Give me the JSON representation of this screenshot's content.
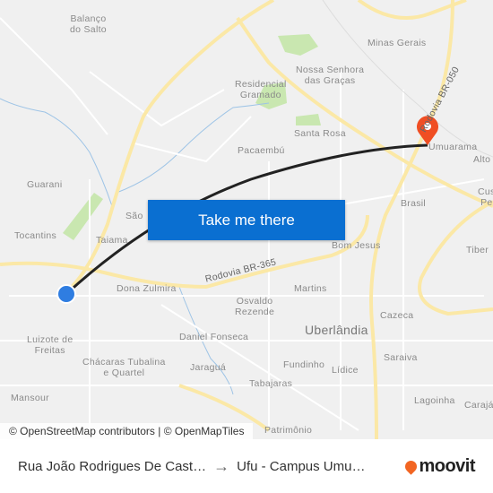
{
  "map": {
    "labels": [
      {
        "text": "Balanço\ndo Salto",
        "cls": ""
      },
      {
        "text": "Minas Gerais",
        "cls": ""
      },
      {
        "text": "Nossa Senhora\ndas Graças",
        "cls": ""
      },
      {
        "text": "Residencial\nGramado",
        "cls": ""
      },
      {
        "text": "Santa Rosa",
        "cls": ""
      },
      {
        "text": "Pacaembú",
        "cls": ""
      },
      {
        "text": "Umuarama",
        "cls": ""
      },
      {
        "text": "Alto",
        "cls": ""
      },
      {
        "text": "Guarani",
        "cls": ""
      },
      {
        "text": "Brasil",
        "cls": ""
      },
      {
        "text": "Cus\nPe",
        "cls": ""
      },
      {
        "text": "São",
        "cls": ""
      },
      {
        "text": "Tocantins",
        "cls": ""
      },
      {
        "text": "Taiama",
        "cls": ""
      },
      {
        "text": "Bom Jesus",
        "cls": ""
      },
      {
        "text": "Tiber",
        "cls": ""
      },
      {
        "text": "Dona Zulmira",
        "cls": ""
      },
      {
        "text": "Martins",
        "cls": ""
      },
      {
        "text": "Osvaldo\nRezende",
        "cls": ""
      },
      {
        "text": "Uberlândia",
        "cls": "city"
      },
      {
        "text": "Cazeca",
        "cls": ""
      },
      {
        "text": "Luizote de\nFreitas",
        "cls": ""
      },
      {
        "text": "Daniel Fonseca",
        "cls": ""
      },
      {
        "text": "Saraiva",
        "cls": ""
      },
      {
        "text": "Chácaras Tubalina\ne Quartel",
        "cls": ""
      },
      {
        "text": "Jaraguá",
        "cls": ""
      },
      {
        "text": "Fundinho",
        "cls": ""
      },
      {
        "text": "Lídice",
        "cls": ""
      },
      {
        "text": "Tabajaras",
        "cls": ""
      },
      {
        "text": "Lagoinha",
        "cls": ""
      },
      {
        "text": "Carajá",
        "cls": ""
      },
      {
        "text": "Mansour",
        "cls": ""
      },
      {
        "text": "Patrimônio",
        "cls": ""
      }
    ],
    "road_labels": {
      "br365": "Rodovia BR-365",
      "br050": "Rodovia BR-050"
    },
    "colors": {
      "route": "#222222",
      "destination_pin": "#f04e23",
      "origin_dot": "#2f7de1",
      "highway": "#fbe8a6",
      "park": "#c9e7b0",
      "water": "#9ec4e6"
    },
    "attribution": "© OpenStreetMap contributors | © OpenMapTiles"
  },
  "cta": {
    "label": "Take me there"
  },
  "footer": {
    "from": "Rua João Rodrigues De Cast…",
    "to": "Ufu - Campus Umu…",
    "brand": "moovit"
  }
}
